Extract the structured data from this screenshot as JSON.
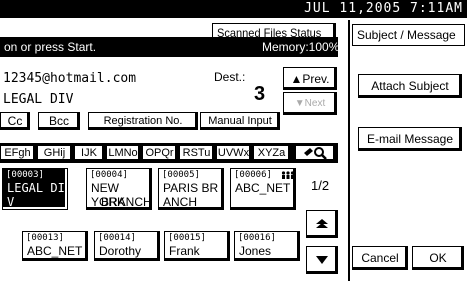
{
  "status_bar": {
    "datetime": "JUL  11,2005  7:11AM"
  },
  "scanned_files_button": "Scanned Files Status",
  "message": {
    "prompt": "on or press Start.",
    "memory": "Memory:100%"
  },
  "destination": {
    "email": "12345@hotmail.com",
    "dest_label": "Dest.:",
    "dest_count": "3",
    "name": "LEGAL DIV",
    "prev_button": "▲Prev.",
    "next_button": "▼Next"
  },
  "tabs": [
    "Cc",
    "Bcc",
    "Registration No.",
    "Manual Input"
  ],
  "alpha_index": [
    "EFgh",
    "GHij",
    "IJK",
    "LMNo",
    "OPQr",
    "RSTu",
    "UVWx",
    "XYZa"
  ],
  "search_icon": "search-icon",
  "address_book": [
    {
      "code": "[00003]",
      "line1": "LEGAL DI",
      "line2": "V",
      "selected": true
    },
    {
      "code": "[00004]",
      "line1": "NEW YORK",
      "line2": "BRANCH",
      "selected": false
    },
    {
      "code": "[00005]",
      "line1": "PARIS BR",
      "line2": "ANCH",
      "selected": false
    },
    {
      "code": "[00006]",
      "line1": "ABC_NET",
      "line2": "",
      "selected": false,
      "group_icon": "group-icon"
    },
    {
      "code": "[00013]",
      "line1": "ABC_NET",
      "line2": "",
      "selected": false
    },
    {
      "code": "[00014]",
      "line1": "Dorothy",
      "line2": "",
      "selected": false
    },
    {
      "code": "[00015]",
      "line1": "Frank",
      "line2": "",
      "selected": false
    },
    {
      "code": "[00016]",
      "line1": "Jones",
      "line2": "",
      "selected": false
    }
  ],
  "page_indicator": "1/2",
  "scroll_up_icon": "scroll-up-icon",
  "scroll_down_icon": "scroll-down-icon",
  "right_panel": {
    "title": "Subject / Message",
    "attach_subject": "Attach Subject",
    "email_message": "E-mail Message",
    "cancel": "Cancel",
    "ok": "OK"
  }
}
